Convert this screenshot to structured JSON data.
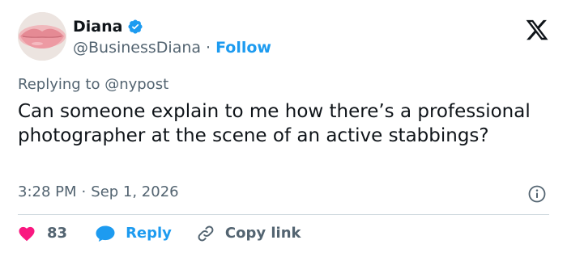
{
  "author": {
    "display_name": "Diana",
    "handle": "@BusinessDiana",
    "separator": "·",
    "follow_label": "Follow",
    "verified": true,
    "avatar": "lips-avatar"
  },
  "reply_context": {
    "text": "Replying to @nypost"
  },
  "tweet": {
    "text": "Can someone explain to me how there’s a professional photographer at the scene of an active stabbings?",
    "time": "3:28 PM",
    "separator": "·",
    "date": "Sep 1, 2026"
  },
  "actions": {
    "like_count": "83",
    "reply_label": "Reply",
    "copy_link_label": "Copy link"
  },
  "icons": {
    "brand": "x-logo-icon",
    "verified": "verified-badge-icon",
    "info": "info-icon",
    "like": "heart-icon",
    "reply": "speech-bubble-icon",
    "copy": "link-icon"
  },
  "colors": {
    "accent": "#1d9bf0",
    "like": "#f91880",
    "text_primary": "#0f1419",
    "text_secondary": "#536471",
    "divider": "#cfd9de"
  }
}
